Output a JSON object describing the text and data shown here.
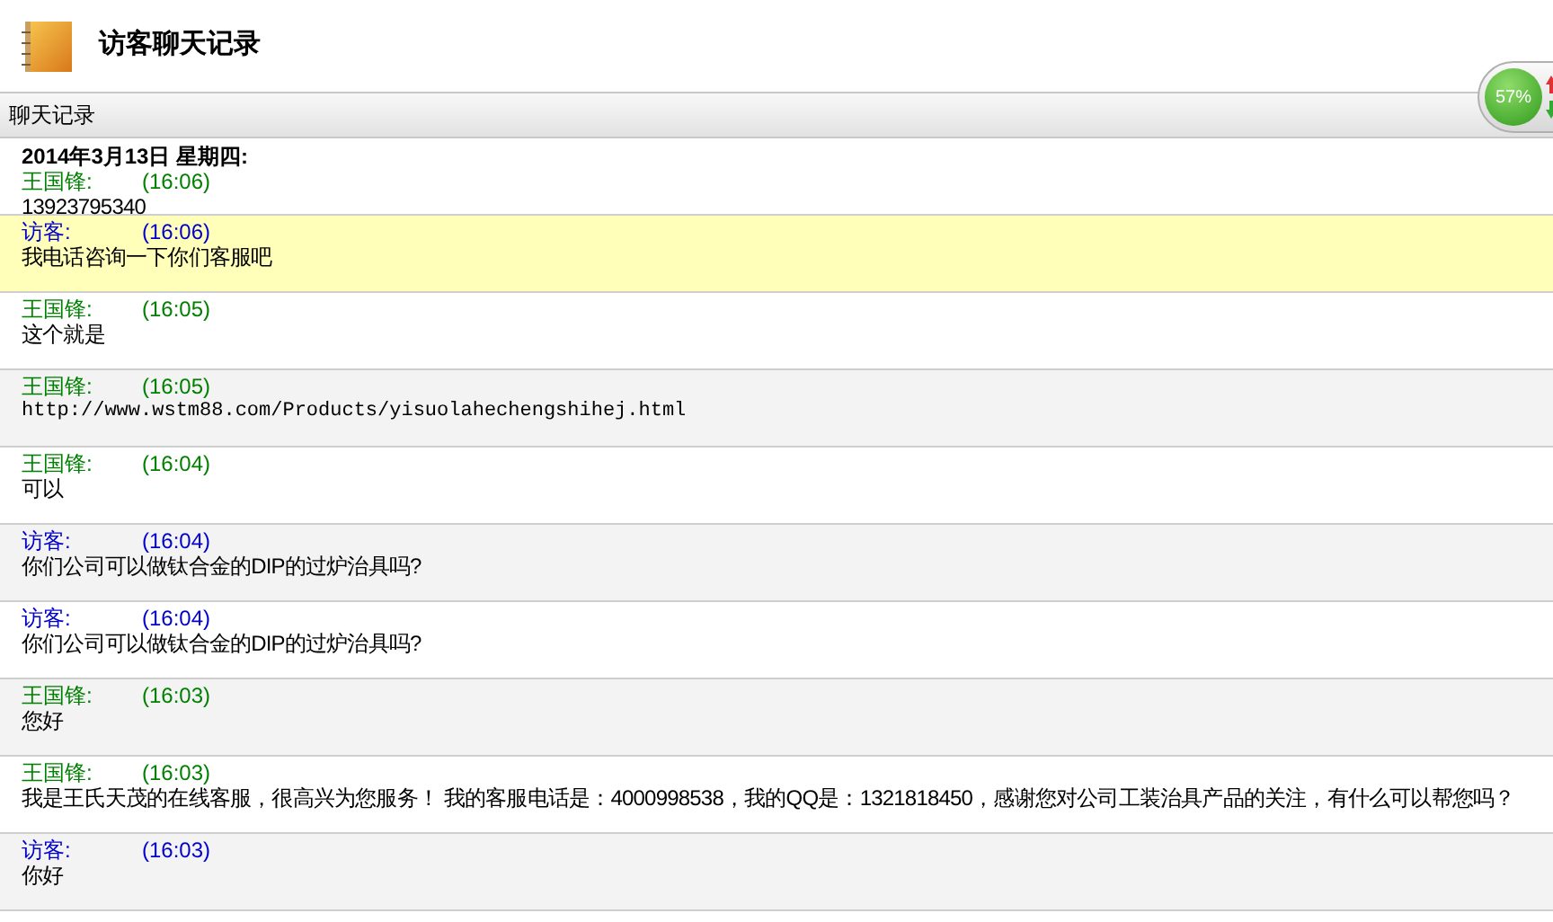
{
  "header": {
    "title": "访客聊天记录"
  },
  "panel": {
    "title": "聊天记录"
  },
  "date": "2014年3月13日  星期四:",
  "messages": [
    {
      "sender": "王国锋:",
      "kind": "agent",
      "time": "(16:06)",
      "text": "13923795340",
      "highlighted": false,
      "mono": false
    },
    {
      "sender": "访客:",
      "kind": "visitor",
      "time": "(16:06)",
      "text": "我电话咨询一下你们客服吧",
      "highlighted": true,
      "mono": false
    },
    {
      "sender": "王国锋:",
      "kind": "agent",
      "time": "(16:05)",
      "text": "这个就是",
      "highlighted": false,
      "mono": false
    },
    {
      "sender": "王国锋:",
      "kind": "agent",
      "time": "(16:05)",
      "text": "http://www.wstm88.com/Products/yisuolahechengshihej.html",
      "highlighted": false,
      "mono": true
    },
    {
      "sender": "王国锋:",
      "kind": "agent",
      "time": "(16:04)",
      "text": "可以",
      "highlighted": false,
      "mono": false
    },
    {
      "sender": "访客:",
      "kind": "visitor",
      "time": "(16:04)",
      "text": "你们公司可以做钛合金的DIP的过炉治具吗?",
      "highlighted": false,
      "mono": false
    },
    {
      "sender": "访客:",
      "kind": "visitor",
      "time": "(16:04)",
      "text": "你们公司可以做钛合金的DIP的过炉治具吗?",
      "highlighted": false,
      "mono": false
    },
    {
      "sender": "王国锋:",
      "kind": "agent",
      "time": "(16:03)",
      "text": "您好",
      "highlighted": false,
      "mono": false
    },
    {
      "sender": "王国锋:",
      "kind": "agent",
      "time": "(16:03)",
      "text": "我是王氏天茂的在线客服，很高兴为您服务！ 我的客服电话是：4000998538，我的QQ是：1321818450，感谢您对公司工装治具产品的关注，有什么可以帮您吗？",
      "highlighted": false,
      "mono": false
    },
    {
      "sender": "访客:",
      "kind": "visitor",
      "time": "(16:03)",
      "text": "你好",
      "highlighted": false,
      "mono": false
    }
  ],
  "speed_widget": {
    "reading": "57%"
  }
}
